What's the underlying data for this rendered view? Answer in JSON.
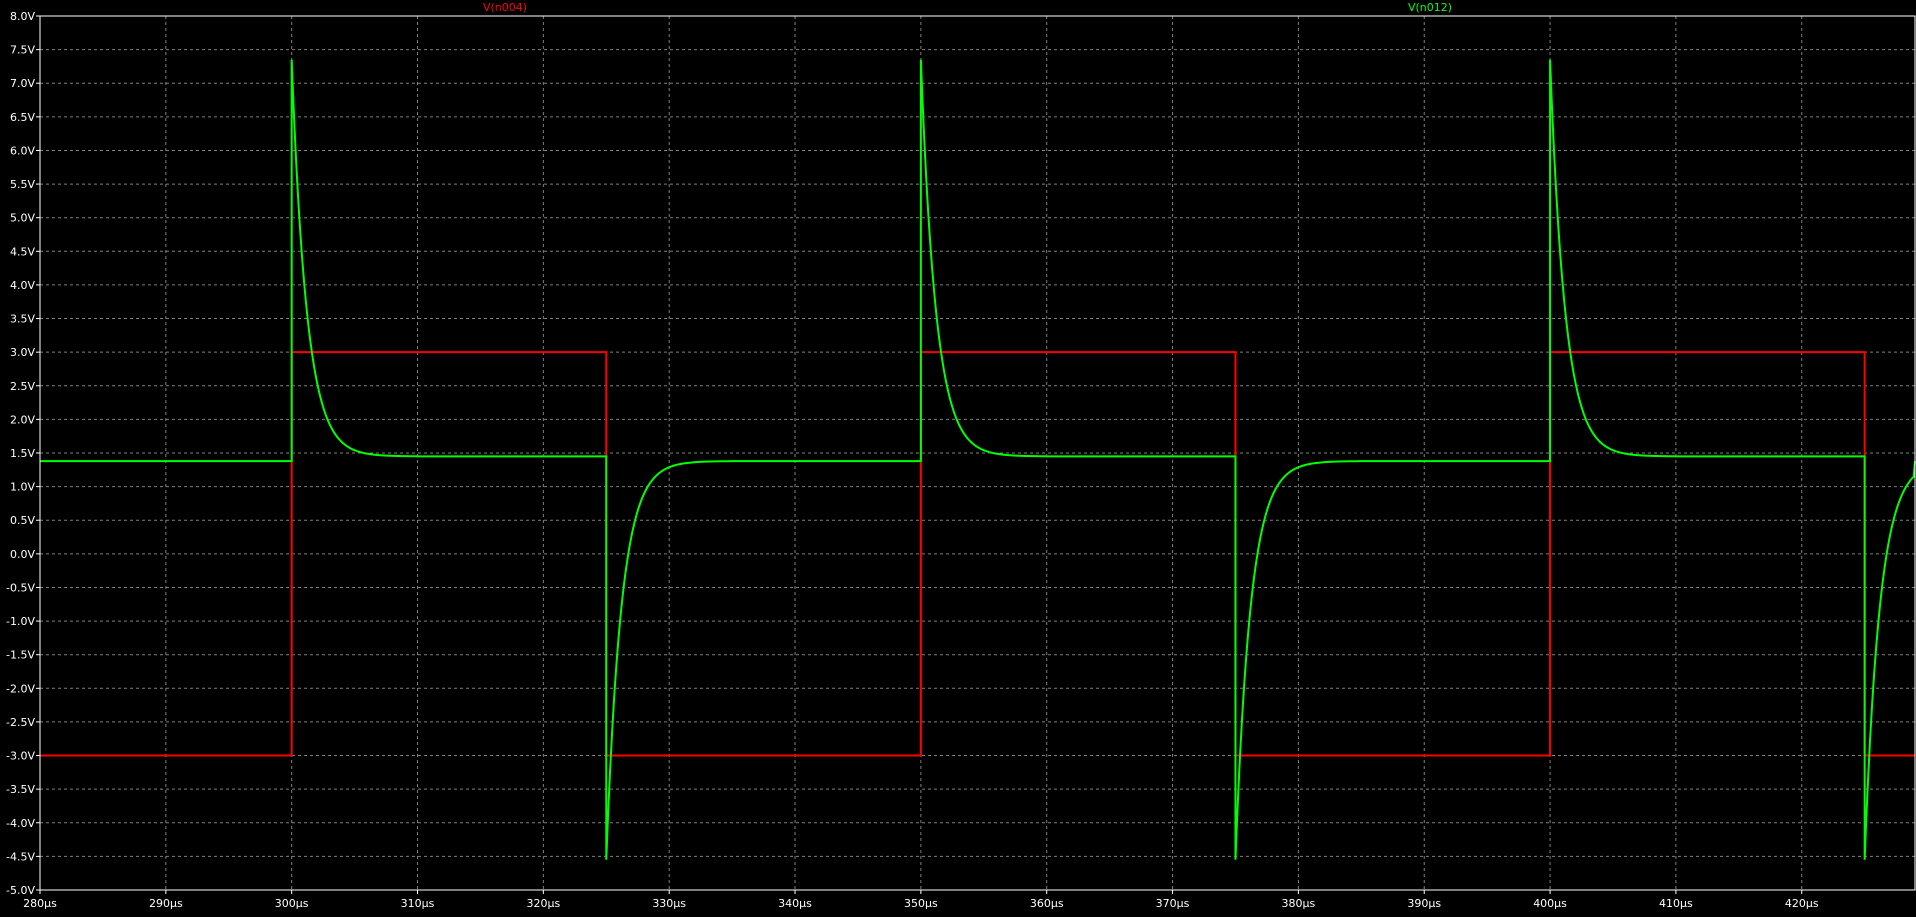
{
  "chart_data": {
    "type": "line",
    "title": "",
    "xlabel": "",
    "ylabel": "",
    "xlim": [
      280,
      429
    ],
    "ylim": [
      -5.0,
      8.0
    ],
    "grid": true,
    "background": "#000000",
    "axis_color": "#ffffff",
    "grid_color": "#808080",
    "x_unit": "µs",
    "y_unit": "V",
    "x_ticks": [
      "280µs",
      "290µs",
      "300µs",
      "310µs",
      "320µs",
      "330µs",
      "340µs",
      "350µs",
      "360µs",
      "370µs",
      "380µs",
      "390µs",
      "400µs",
      "410µs",
      "420µs"
    ],
    "x_tick_values": [
      280,
      290,
      300,
      310,
      320,
      330,
      340,
      350,
      360,
      370,
      380,
      390,
      400,
      410,
      420
    ],
    "y_ticks": [
      "8.0V",
      "7.5V",
      "7.0V",
      "6.5V",
      "6.0V",
      "5.5V",
      "5.0V",
      "4.5V",
      "4.0V",
      "3.5V",
      "3.0V",
      "2.5V",
      "2.0V",
      "1.5V",
      "1.0V",
      "0.5V",
      "0.0V",
      "-0.5V",
      "-1.0V",
      "-1.5V",
      "-2.0V",
      "-2.5V",
      "-3.0V",
      "-3.5V",
      "-4.0V",
      "-4.5V",
      "-5.0V"
    ],
    "y_tick_values": [
      8.0,
      7.5,
      7.0,
      6.5,
      6.0,
      5.5,
      5.0,
      4.5,
      4.0,
      3.5,
      3.0,
      2.5,
      2.0,
      1.5,
      1.0,
      0.5,
      0.0,
      -0.5,
      -1.0,
      -1.5,
      -2.0,
      -2.5,
      -3.0,
      -3.5,
      -4.0,
      -4.5,
      -5.0
    ],
    "legend_placement": "top",
    "series": [
      {
        "name": "V(n004)",
        "color": "#ff0000",
        "shape": "square",
        "low": -3.0,
        "high": 3.0,
        "rise_times": [
          300,
          350,
          400
        ],
        "fall_times": [
          325,
          375,
          425
        ],
        "x": [
          280,
          300,
          300,
          325,
          325,
          350,
          350,
          375,
          375,
          400,
          400,
          425,
          425,
          429
        ],
        "y": [
          -3.0,
          -3.0,
          3.0,
          3.0,
          -3.0,
          -3.0,
          3.0,
          3.0,
          -3.0,
          -3.0,
          3.0,
          3.0,
          -3.0,
          -3.0
        ]
      },
      {
        "name": "V(n012)",
        "color": "#00ff00",
        "shape": "differentiated-square",
        "baseline_after_rise": 1.45,
        "baseline_after_fall": 1.38,
        "peak": 7.35,
        "trough": -4.55,
        "decay_us": 1.2,
        "rise_times": [
          300,
          350,
          400
        ],
        "fall_times": [
          325,
          375,
          425
        ],
        "start_level": 1.38
      }
    ]
  }
}
